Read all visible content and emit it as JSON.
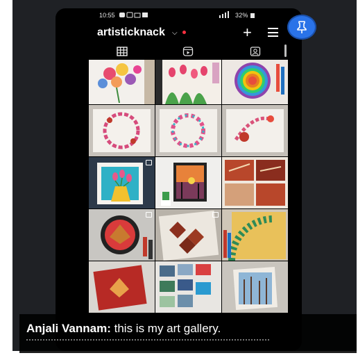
{
  "status_bar": {
    "time": "10:55",
    "right_info": "32%"
  },
  "profile": {
    "username": "artisticknack"
  },
  "caption": {
    "speaker": "Anjali Vannam:",
    "text": "this is my art gallery."
  },
  "colors": {
    "accent": "#2a73e8",
    "notification_dot": "#ff3040",
    "background": "#000000"
  },
  "icons": {
    "status": [
      "message-icon",
      "video-icon",
      "notification-icon",
      "image-icon",
      "signal-icon",
      "battery-icon"
    ],
    "header": [
      "chevron-down-icon",
      "plus-icon",
      "menu-icon"
    ],
    "tabs": [
      "grid-icon",
      "reels-icon",
      "tagged-icon"
    ],
    "overlay": [
      "pin-icon"
    ]
  },
  "gallery": [
    {
      "name": "floral-bouquet-watercolor"
    },
    {
      "name": "tulip-field-painting"
    },
    {
      "name": "rainbow-mandala"
    },
    {
      "name": "floral-wreath-card"
    },
    {
      "name": "rose-wreath-card"
    },
    {
      "name": "be-joyful-card"
    },
    {
      "name": "tulip-vase-painting"
    },
    {
      "name": "sunset-canvas"
    },
    {
      "name": "leaf-and-tiles-collage"
    },
    {
      "name": "autumn-leaf-circle"
    },
    {
      "name": "leaf-pattern-painting"
    },
    {
      "name": "yellow-mandala"
    },
    {
      "name": "red-leaf-painting"
    },
    {
      "name": "mini-canvas-collection"
    },
    {
      "name": "forest-watercolor"
    }
  ]
}
